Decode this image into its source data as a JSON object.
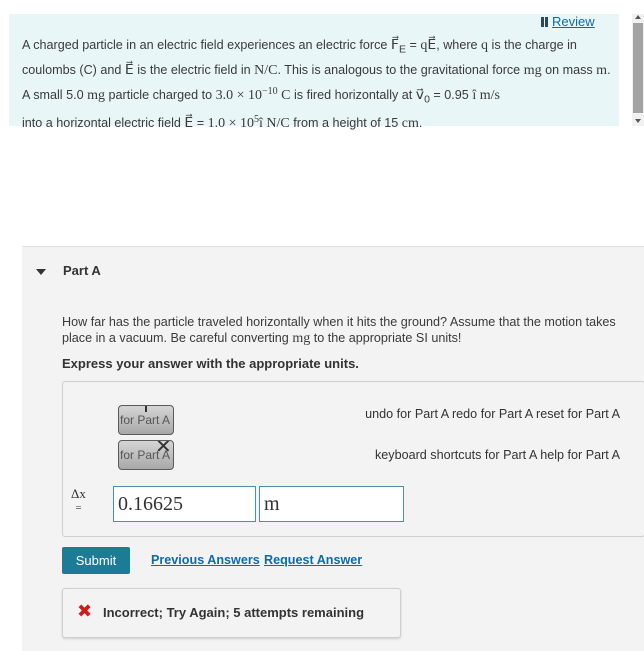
{
  "review": {
    "label": "Review"
  },
  "problem": {
    "p1": "A charged particle in an electric field experiences an electric force ",
    "f_force": "F⃗",
    "f_sub": "E",
    "f_eq": " = ",
    "f_qE": "qE⃗",
    "p2": ", where ",
    "f_q": "q",
    "p3": " is the charge in coulombs (C) and ",
    "f_E": "E⃗",
    "p4": " is the electric field in ",
    "f_unit": "N/C",
    "p5": ". This is analogous to the gravitational force ",
    "f_mg": "mg",
    "p6": " on mass ",
    "f_m": "m",
    "p7": ". A small 5.0 ",
    "f_mgunit": "mg",
    "p8": " particle charged to ",
    "f_charge": "3.0 × 10",
    "f_charge_exp": "−10",
    "f_C": " C",
    "p9": " is fired horizontally at ",
    "f_v0": "v⃗",
    "f_v0sub": "0",
    "p10": " = 0.95 ",
    "f_ihat": "î",
    "f_ms": " m/s",
    "p11": " into a horizontal electric field ",
    "f_E2": "E⃗",
    "p12": " = ",
    "f_field": "1.0 × 10",
    "f_field_exp": "5",
    "f_ihat2": "î",
    "f_NC": " N/C",
    "p13": " from a height of 15 ",
    "f_cm": "cm",
    "p14": "."
  },
  "part": {
    "label": "Part A",
    "question_a": "How far has the particle traveled horizontally when it hits the ground? Assume that the motion takes place in a vacuum. Be careful converting ",
    "question_mg": "mg",
    "question_b": " to the appropriate SI units!",
    "instruction": "Express your answer with the appropriate units."
  },
  "toolbar": {
    "template_btn": "for Part A",
    "units_btn": "for Part A",
    "undo": "undo for Part A",
    "redo": "redo for Part A",
    "reset": "reset for Part A",
    "keyboard": "keyboard shortcuts for Part A",
    "help": "help for Part A"
  },
  "answer": {
    "var_label": "Δx",
    "eq": "=",
    "value": "0.16625",
    "unit": "m"
  },
  "actions": {
    "submit": "Submit",
    "previous": "Previous Answers",
    "request": "Request Answer"
  },
  "feedback": {
    "icon": "✖",
    "message": "Incorrect; Try Again; 5 attempts remaining"
  },
  "colors": {
    "problem_bg": "#e8f6f7",
    "submit_bg": "#1c7c96",
    "link": "#0e6ba8",
    "error": "#d11a1a"
  }
}
